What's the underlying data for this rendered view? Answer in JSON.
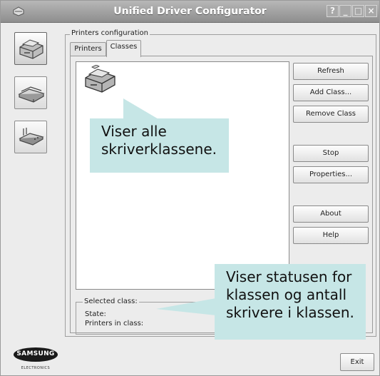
{
  "window": {
    "title": "Unified Driver Configurator",
    "controls": {
      "help": "?",
      "minimize": "_",
      "maximize": "□",
      "close": "×"
    }
  },
  "sidebar": {
    "items": [
      {
        "icon": "printer-icon"
      },
      {
        "icon": "scanner-icon"
      },
      {
        "icon": "port-icon"
      }
    ]
  },
  "group": {
    "label": "Printers configuration"
  },
  "tabs": [
    {
      "label": "Printers",
      "active": false
    },
    {
      "label": "Classes",
      "active": true
    }
  ],
  "class_list": {
    "items": [
      {
        "icon": "printer-class-icon"
      }
    ]
  },
  "actions": {
    "refresh": "Refresh",
    "add_class": "Add Class...",
    "remove_class": "Remove Class",
    "stop": "Stop",
    "properties": "Properties...",
    "about": "About",
    "help": "Help"
  },
  "selected_class": {
    "title": "Selected class:",
    "state_label": "State:",
    "printers_label": "Printers in class:"
  },
  "callouts": {
    "top": [
      "Viser alle",
      "skriverklassene."
    ],
    "bottom": [
      "Viser statusen for",
      "klassen og antall",
      "skrivere i klassen."
    ]
  },
  "footer": {
    "exit": "Exit"
  },
  "brand": {
    "name": "SAMSUNG",
    "sub": "ELECTRONICS"
  },
  "colors": {
    "callout": "#c6e6e6",
    "titlebar": "#9e9e9e",
    "window": "#ececec"
  }
}
